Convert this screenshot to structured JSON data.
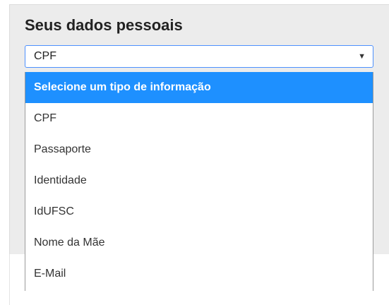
{
  "section": {
    "title": "Seus dados pessoais"
  },
  "select": {
    "value": "CPF",
    "arrow_icon": "dropdown-arrow-icon"
  },
  "dropdown": {
    "highlight_color": "#1e90ff",
    "options": [
      {
        "label": "Selecione um tipo de informação",
        "highlighted": true
      },
      {
        "label": "CPF",
        "highlighted": false
      },
      {
        "label": "Passaporte",
        "highlighted": false
      },
      {
        "label": "Identidade",
        "highlighted": false
      },
      {
        "label": "IdUFSC",
        "highlighted": false
      },
      {
        "label": "Nome da Mãe",
        "highlighted": false
      },
      {
        "label": "E-Mail",
        "highlighted": false
      }
    ]
  }
}
